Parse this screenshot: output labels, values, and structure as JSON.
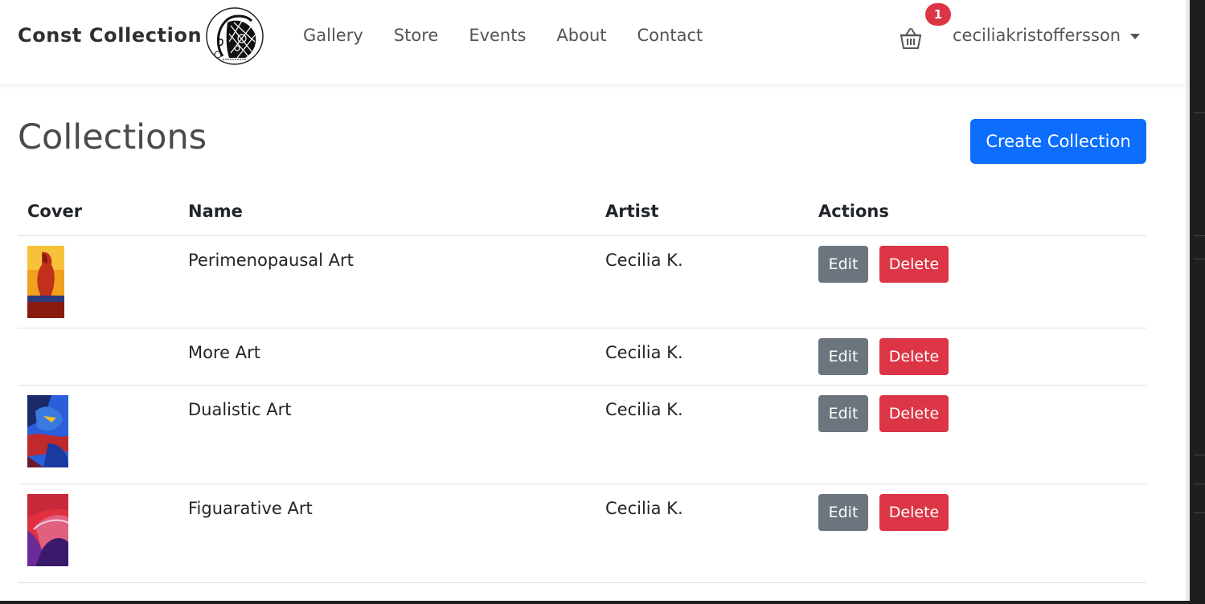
{
  "navbar": {
    "brand": "Const Collection",
    "links": [
      "Gallery",
      "Store",
      "Events",
      "About",
      "Contact"
    ],
    "cart_count": "1",
    "username": "ceciliakristoffersson"
  },
  "header": {
    "title": "Collections",
    "create_button": "Create Collection"
  },
  "table": {
    "columns": [
      "Cover",
      "Name",
      "Artist",
      "Actions"
    ],
    "rows": [
      {
        "name": "Perimenopausal Art",
        "artist": "Cecilia K.",
        "edit": "Edit",
        "delete": "Delete",
        "has_cover": true,
        "cover_colors": [
          "#f2a11f",
          "#c0301a",
          "#6a1a10"
        ]
      },
      {
        "name": "More Art",
        "artist": "Cecilia K.",
        "edit": "Edit",
        "delete": "Delete",
        "has_cover": false
      },
      {
        "name": "Dualistic Art",
        "artist": "Cecilia K.",
        "edit": "Edit",
        "delete": "Delete",
        "has_cover": true,
        "cover_colors": [
          "#2b5fd9",
          "#c02a2a",
          "#1a2a6a"
        ]
      },
      {
        "name": "Figuarative Art",
        "artist": "Cecilia K.",
        "edit": "Edit",
        "delete": "Delete",
        "has_cover": true,
        "cover_colors": [
          "#e03040",
          "#6a2a9a",
          "#3a1a6a"
        ]
      }
    ]
  },
  "colors": {
    "primary": "#0d6efd",
    "secondary": "#6c757d",
    "danger": "#dc3545"
  }
}
